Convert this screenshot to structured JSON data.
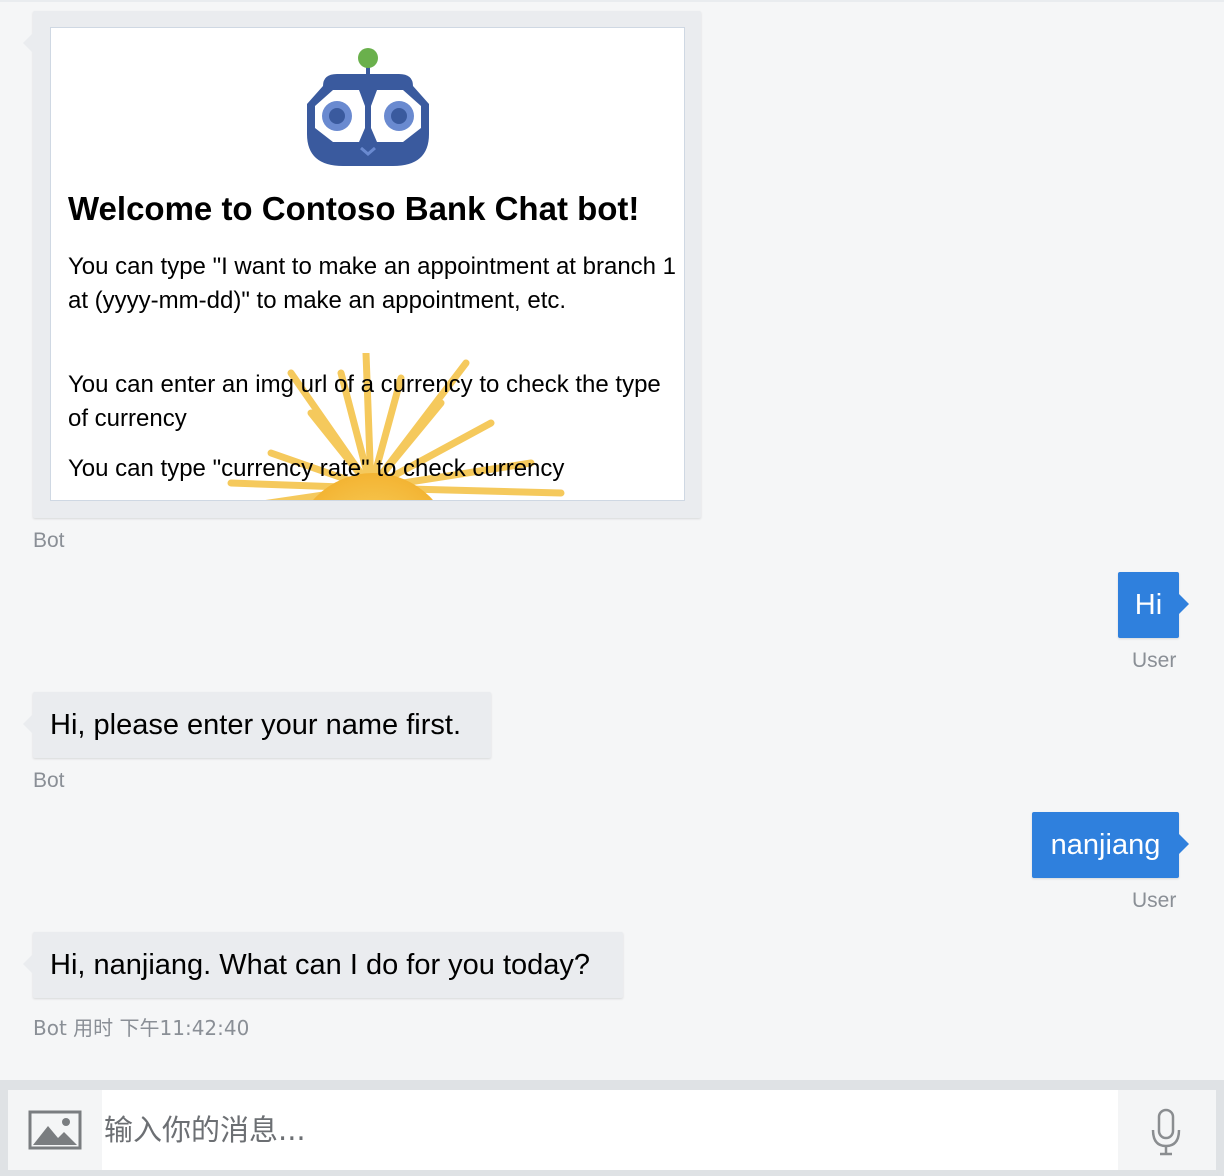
{
  "welcome_card": {
    "title": "Welcome to Contoso Bank Chat bot!",
    "paragraphs": [
      "You can type \"I want to make an appointment at branch 1 at (yyyy-mm-dd)\" to make an appointment, etc.",
      "You can enter an img url of a currency to check the type of currency",
      "You can type \"currency rate\" to check currency"
    ],
    "logo_icon": "robot-owl-logo",
    "background_icon": "sun-illustration"
  },
  "messages": [
    {
      "from": "bot",
      "text": "",
      "meta": "Bot"
    },
    {
      "from": "user",
      "text": "Hi",
      "meta": "User"
    },
    {
      "from": "bot",
      "text": "Hi, please enter your name first.",
      "meta": "Bot"
    },
    {
      "from": "user",
      "text": "nanjiang",
      "meta": "User"
    },
    {
      "from": "bot",
      "text": "Hi, nanjiang. What can I do for you today?",
      "meta": "Bot 用时 下午11:42:40"
    }
  ],
  "input": {
    "placeholder": "输入你的消息...",
    "value": "",
    "upload_icon": "image-upload-icon",
    "mic_icon": "microphone-icon"
  },
  "colors": {
    "background": "#f5f6f7",
    "bot_bubble": "#eaecef",
    "user_bubble": "#2f80dd",
    "meta_text": "#8a8f96",
    "logo_blue": "#3a5a9e",
    "logo_green": "#6ab04c"
  }
}
